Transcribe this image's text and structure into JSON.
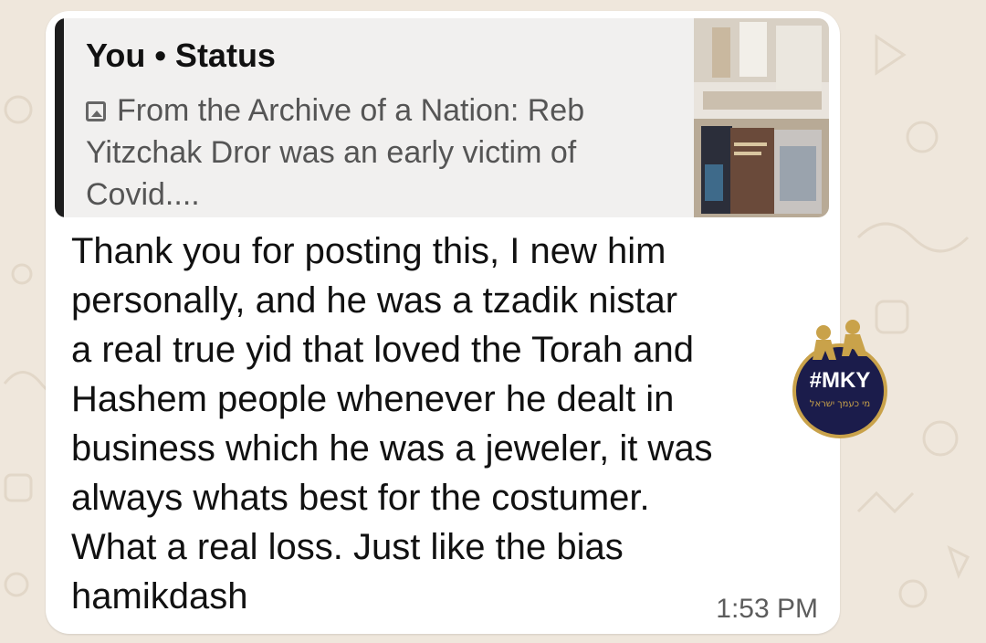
{
  "reply": {
    "author": "You • Status",
    "icon": "image-icon",
    "quoted_text": "From the Archive of a Nation: Reb Yitzchak Dror was an early victim of Covid...."
  },
  "message": {
    "text": "Thank you for posting this, I new him\npersonally, and he was a tzadik nistar\na real true yid that loved the Torah and\nHashem people whenever he dealt in\nbusiness which he was a jeweler, it was\nalways whats best for the costumer.\nWhat a real loss. Just like the bias\nhamikdash",
    "time": "1:53 PM"
  },
  "sticker": {
    "label": "#MKY",
    "subtitle": "מי כעמך ישראל"
  },
  "colors": {
    "wallpaper": "#efe7dc",
    "bubble": "#ffffff",
    "quote_background": "#f1f0ef",
    "quote_bar": "#1d1d1d",
    "sticker_navy": "#1b1c4b",
    "sticker_gold": "#c9a24a"
  }
}
